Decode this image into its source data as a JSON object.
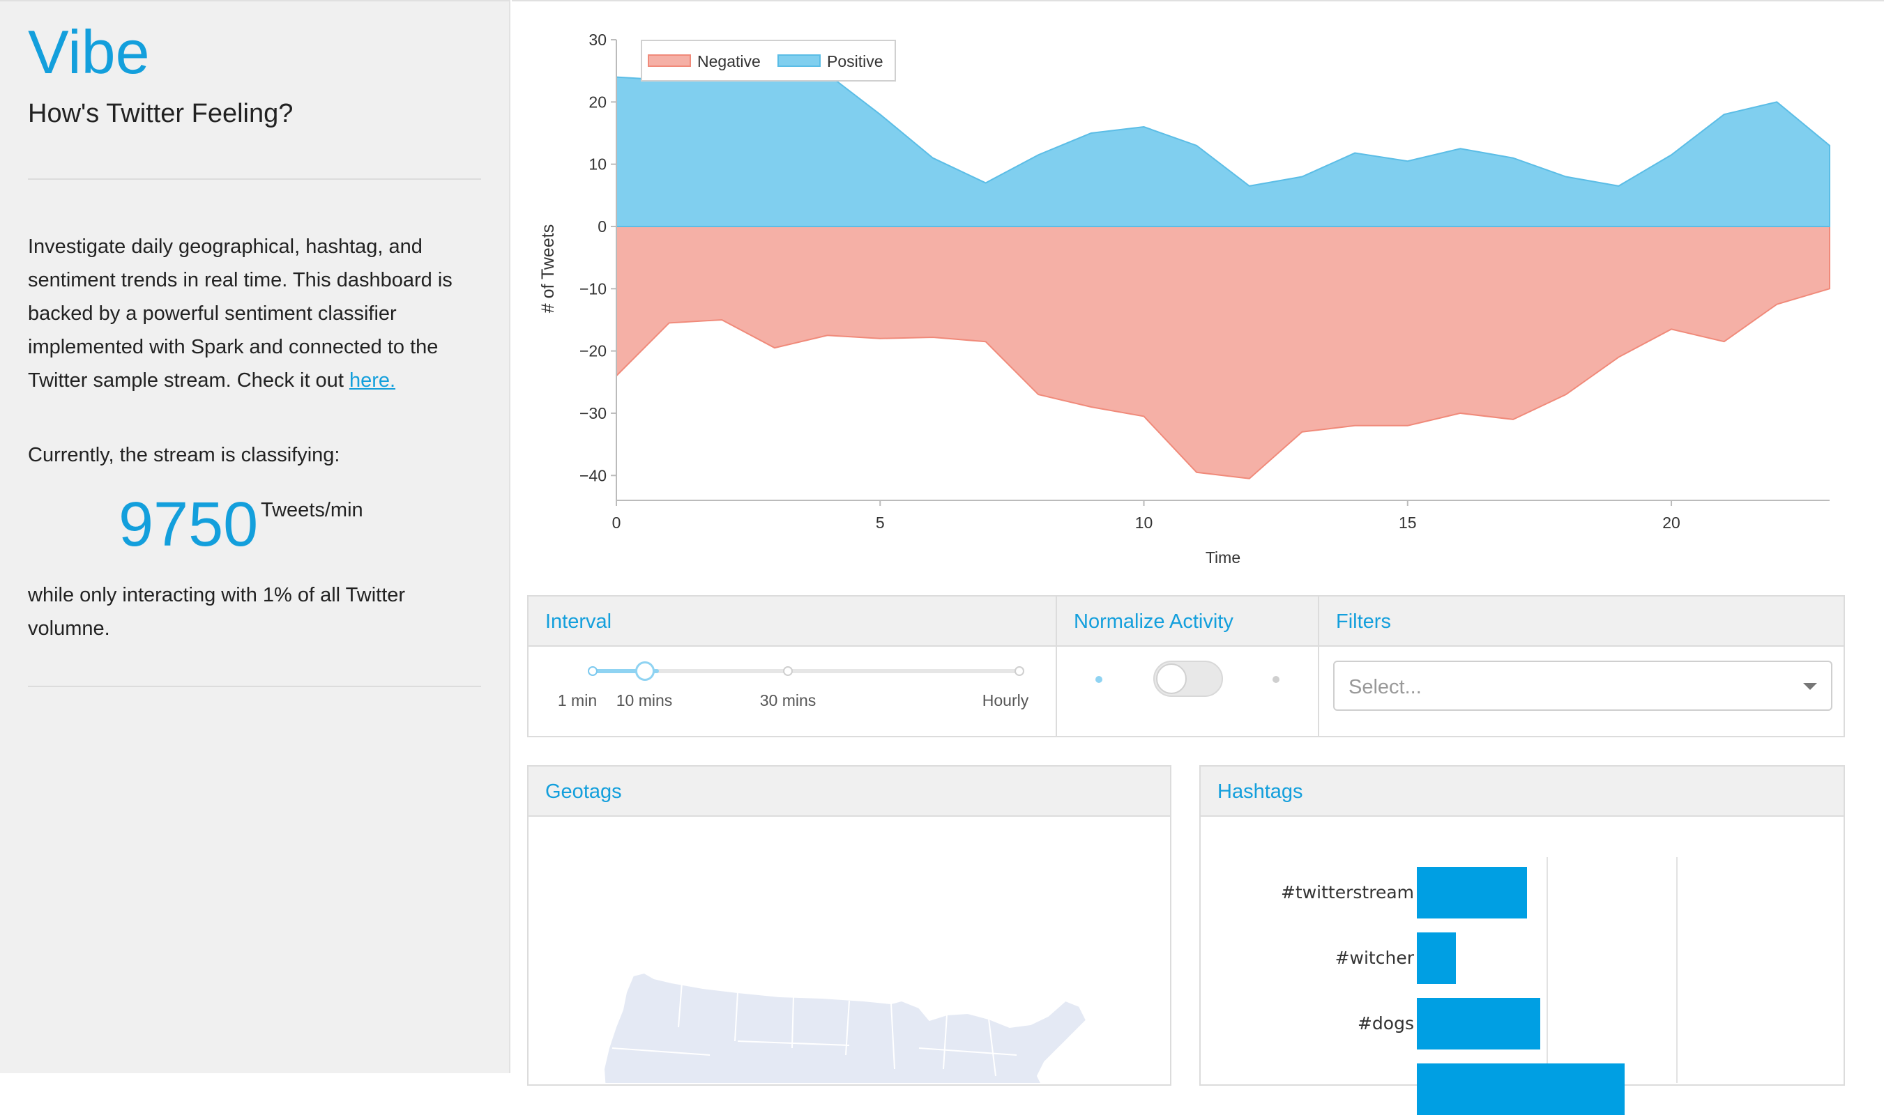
{
  "sidebar": {
    "title": "Vibe",
    "subtitle": "How's Twitter Feeling?",
    "intro_text": "Investigate daily geographical, hashtag, and sentiment trends in real time. This dashboard is backed by a powerful sentiment classifier implemented with Spark and connected to the Twitter sample stream. Check it out ",
    "intro_link": "here.",
    "currently_label": "Currently, the stream is classifying:",
    "rate_value": "9750",
    "rate_unit": "Tweets/min",
    "after_text": "while only interacting with 1% of all Twitter volumne."
  },
  "chart_data": {
    "type": "area",
    "xlabel": "Time",
    "ylabel": "# of Tweets",
    "xlim": [
      0,
      23
    ],
    "ylim": [
      -44,
      30
    ],
    "xticks": [
      0,
      5,
      10,
      15,
      20
    ],
    "yticks": [
      30,
      20,
      10,
      0,
      -10,
      -20,
      -30,
      -40
    ],
    "legend_position": "top-left",
    "x": [
      0,
      1,
      2,
      3,
      4,
      5,
      6,
      7,
      8,
      9,
      10,
      11,
      12,
      13,
      14,
      15,
      16,
      17,
      18,
      19,
      20,
      21,
      22,
      23
    ],
    "series": [
      {
        "name": "Negative",
        "color": "#f5b0a6",
        "stroke": "#f08a7a",
        "values": [
          -24,
          -15.5,
          -15,
          -19.5,
          -17.5,
          -18,
          -17.8,
          -18.5,
          -27,
          -29,
          -30.5,
          -39.5,
          -40.5,
          -33,
          -32,
          -32,
          -30,
          -31,
          -27,
          -21,
          -16.5,
          -18.5,
          -12.5,
          -10
        ]
      },
      {
        "name": "Positive",
        "color": "#80cfef",
        "stroke": "#5bbde6",
        "values": [
          24,
          23.5,
          24.5,
          25,
          24.5,
          18,
          11,
          7,
          11.5,
          15,
          16,
          13,
          6.5,
          8,
          11.8,
          10.5,
          12.5,
          11,
          8,
          6.5,
          11.5,
          18,
          20,
          13
        ]
      }
    ]
  },
  "controls": {
    "interval": {
      "header": "Interval",
      "ticks": [
        "1 min",
        "10 mins",
        "30 mins",
        "Hourly"
      ],
      "selected": "10 mins"
    },
    "normalize": {
      "header": "Normalize Activity",
      "enabled": false
    },
    "filters": {
      "header": "Filters",
      "placeholder": "Select..."
    }
  },
  "geotags": {
    "header": "Geotags"
  },
  "hashtags": {
    "header": "Hashtags",
    "items": [
      {
        "label": "#twitterstream",
        "value": 85
      },
      {
        "label": "#witcher",
        "value": 30
      },
      {
        "label": "#dogs",
        "value": 95
      },
      {
        "label": "",
        "value": 160
      }
    ],
    "scale_max": 200
  },
  "colors": {
    "accent": "#139fdc",
    "negative": "#f5b0a6",
    "positive": "#80cfef",
    "bar": "#009fe3"
  }
}
